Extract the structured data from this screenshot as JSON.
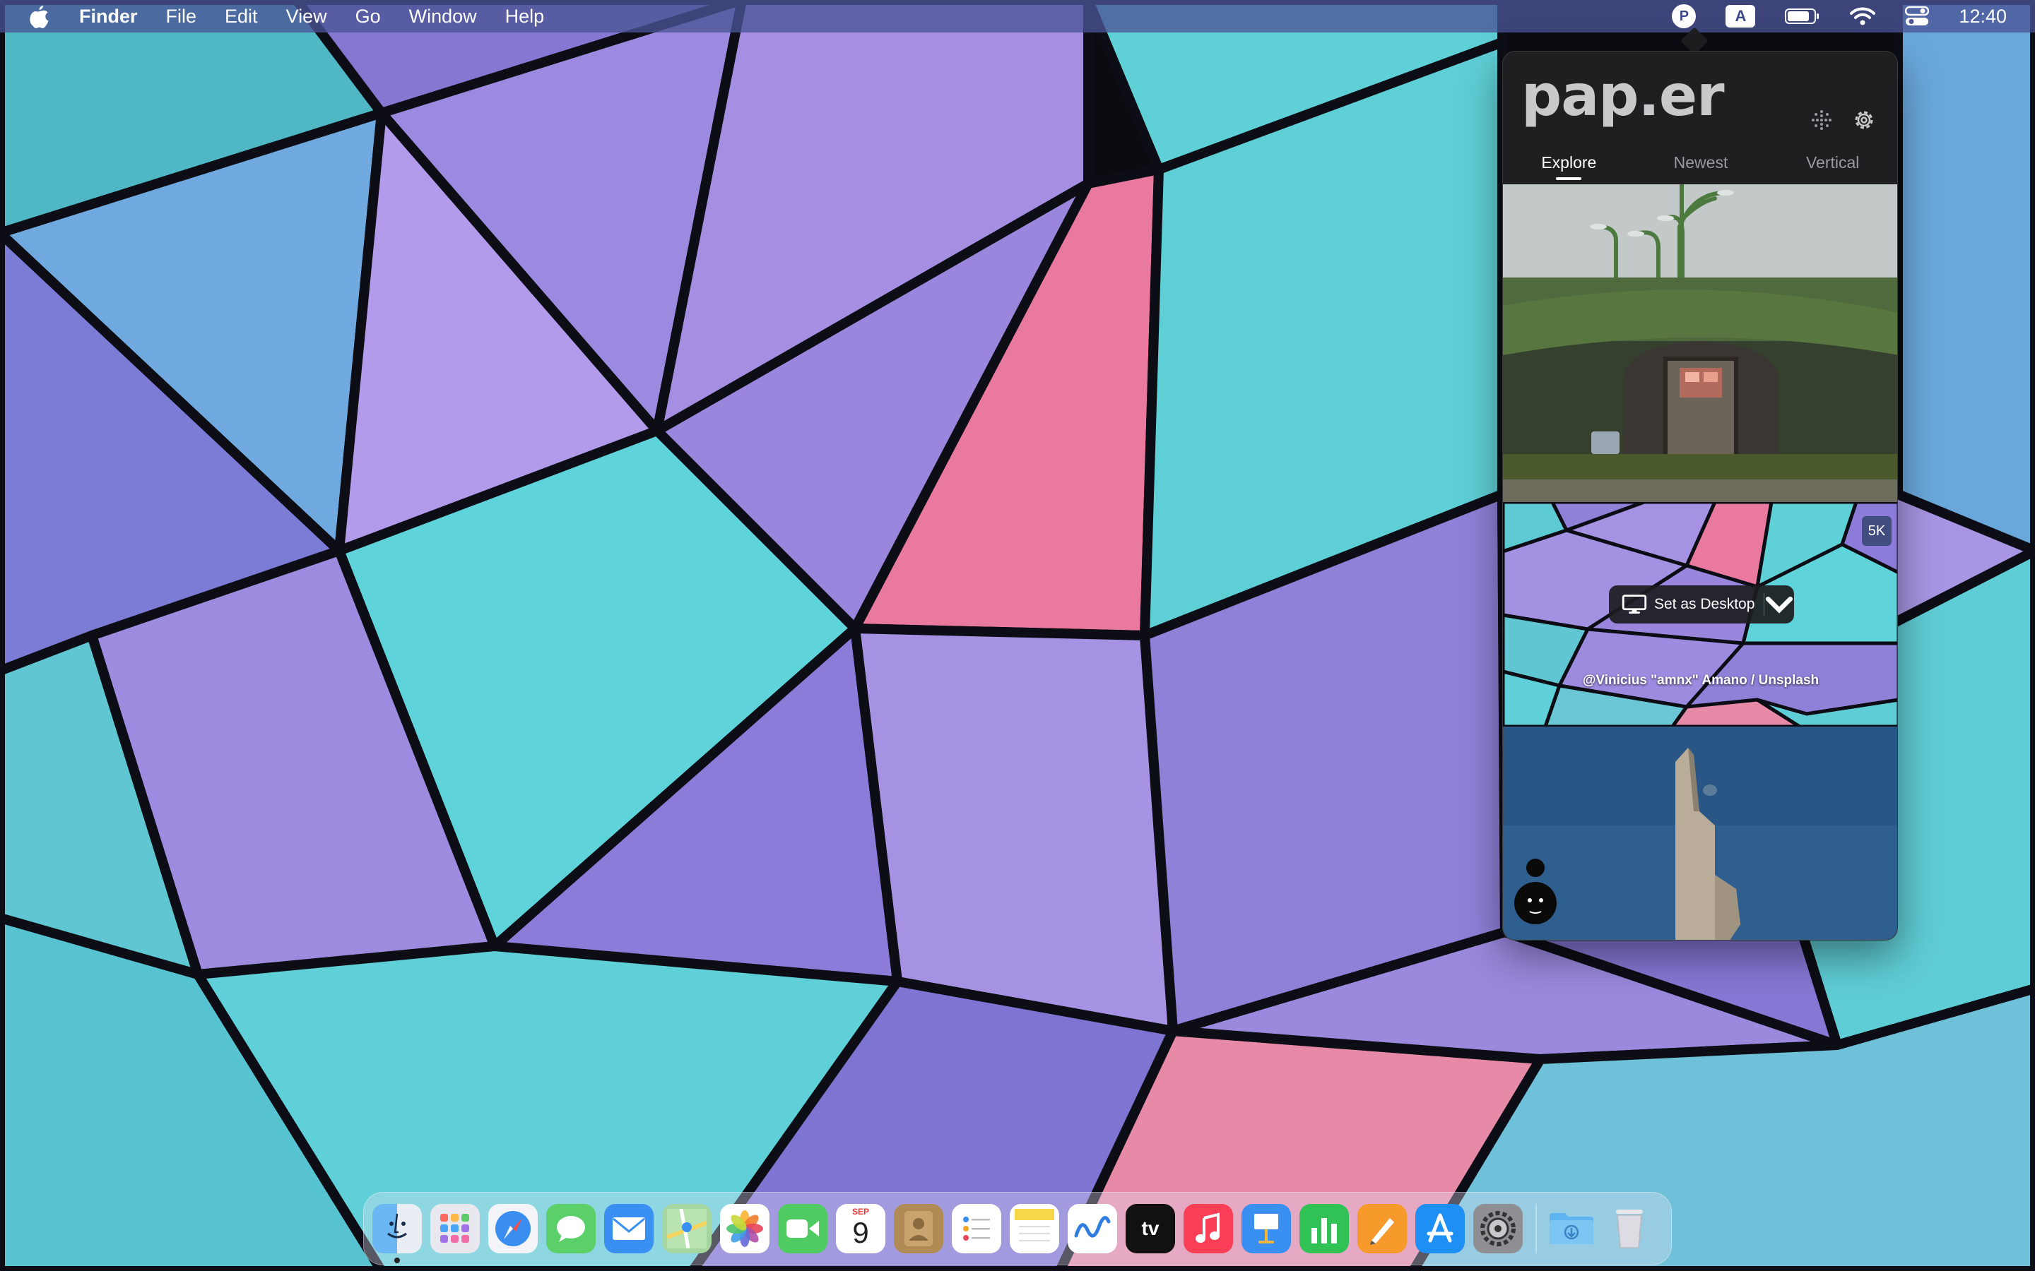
{
  "menubar": {
    "app_name": "Finder",
    "menus": [
      "File",
      "Edit",
      "View",
      "Go",
      "Window",
      "Help"
    ],
    "tray": {
      "paper_icon_letter": "P",
      "input_source_letter": "A",
      "clock": "12:40"
    }
  },
  "popover": {
    "logo": "pap.er",
    "tabs": [
      "Explore",
      "Newest",
      "Vertical"
    ],
    "active_tab": "Explore",
    "wallpaper_card": {
      "badge": "5K",
      "set_desktop_label": "Set as Desktop",
      "credit": "@Vinicius \"amnx\" Amano / Unsplash"
    }
  },
  "dock": {
    "apps": [
      "Finder",
      "Launchpad",
      "Safari",
      "Messages",
      "Mail",
      "Maps",
      "Photos",
      "FaceTime",
      "Calendar",
      "Contacts",
      "Reminders",
      "Notes",
      "Freeform",
      "TV",
      "Music",
      "Keynote",
      "Numbers",
      "Pages",
      "App Store",
      "System Settings"
    ],
    "calendar_month": "SEP",
    "calendar_day": "9",
    "tv_label": "tv",
    "extras": [
      "Downloads",
      "Trash"
    ]
  },
  "colors": {
    "wallpaper_purple": "#8f80d8",
    "wallpaper_teal": "#5fd0d6",
    "wallpaper_pink": "#e9799e",
    "popover_bg": "#1f1f22"
  }
}
